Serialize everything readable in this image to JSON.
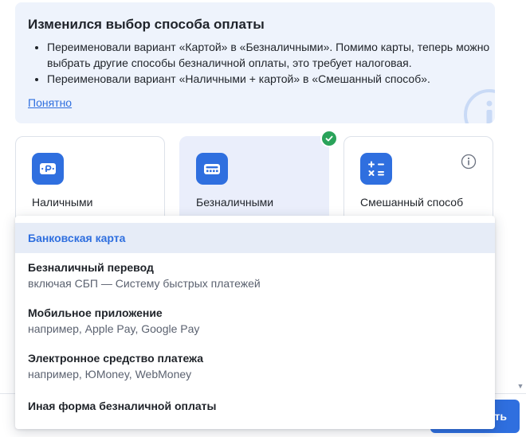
{
  "notice": {
    "title": "Изменился выбор способа оплаты",
    "items": [
      "Переименовали вариант «Картой» в «Безналичными». Помимо карты, теперь можно выбрать другие способы безналичной оплаты, это требует налоговая.",
      "Переименовали вариант «Наличными + картой» в «Смешанный способ»."
    ],
    "link_label": "Понятно",
    "icon": "info-icon"
  },
  "payment_methods": [
    {
      "label": "Наличными",
      "icon": "cash-icon",
      "selected": false
    },
    {
      "label": "Безналичными",
      "icon": "card-terminal-icon",
      "selected": true
    },
    {
      "label": "Смешанный способ",
      "icon": "calculator-icon",
      "selected": false
    }
  ],
  "dropdown": {
    "items": [
      {
        "title": "Банковская карта",
        "subtitle": "",
        "active": true
      },
      {
        "title": "Безналичный перевод",
        "subtitle": "включая СБП — Систему быстрых платежей",
        "active": false
      },
      {
        "title": "Мобильное приложение",
        "subtitle": "например, Apple Pay, Google Pay",
        "active": false
      },
      {
        "title": "Электронное средство платежа",
        "subtitle": "например, ЮMoney, WebMoney",
        "active": false
      },
      {
        "title": "Иная форма безналичной оплаты",
        "subtitle": "",
        "active": false
      }
    ]
  },
  "footer": {
    "primary_button_visible_text": "ть"
  },
  "colors": {
    "accent": "#2f6fdf",
    "success": "#2aa35a",
    "notice_bg": "#eef3fc",
    "selected_card_bg": "#eaeefb",
    "active_item_bg": "#e6ecf7"
  }
}
